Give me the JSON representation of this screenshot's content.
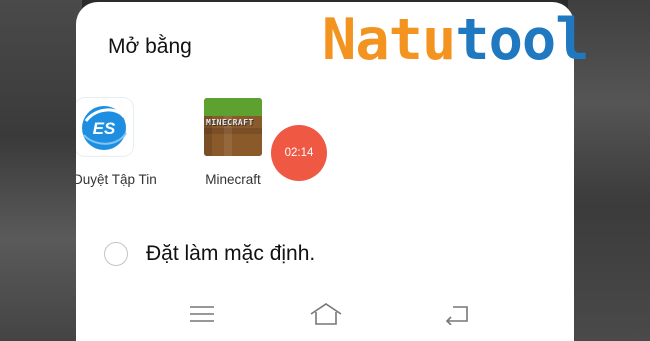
{
  "sheet": {
    "title": "Mở bằng"
  },
  "apps": [
    {
      "label": "ES Duyệt Tập Tin",
      "icon": "es-file-explorer-icon",
      "icon_text": "ES"
    },
    {
      "label": "Minecraft",
      "icon": "minecraft-icon",
      "icon_text": "MINECRAFT"
    }
  ],
  "timer": {
    "text": "02:14",
    "color": "#ef5843"
  },
  "default_option": {
    "label": "Đặt làm mặc định.",
    "checked": false
  },
  "navbar": {
    "items": [
      "menu-icon",
      "home-icon",
      "back-icon"
    ]
  },
  "watermark": {
    "part1": "Natu",
    "part2": "tool",
    "color1": "#f39420",
    "color2": "#1f78c0"
  }
}
